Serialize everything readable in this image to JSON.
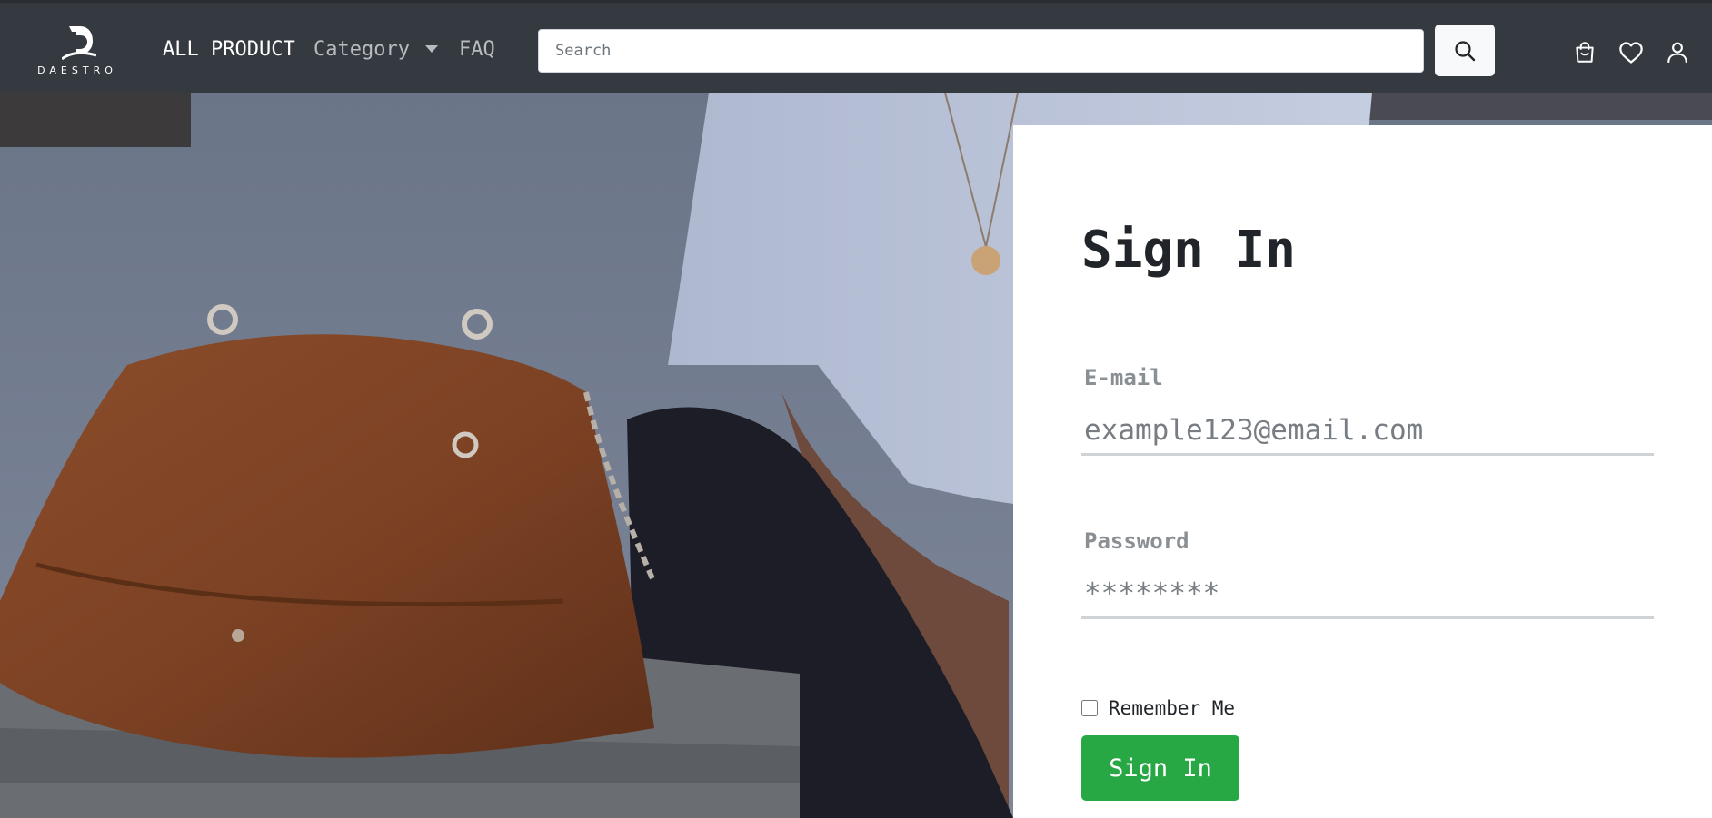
{
  "brand": {
    "name": "DAESTRO"
  },
  "nav": {
    "all_product": "ALL PRODUCT",
    "category": "Category",
    "faq": "FAQ"
  },
  "search": {
    "placeholder": "Search",
    "button_icon": "search-icon"
  },
  "header_icons": [
    "cart-icon",
    "heart-icon",
    "user-icon"
  ],
  "signin": {
    "title": "Sign In",
    "email_label": "E-mail",
    "email_placeholder": "example123@email.com",
    "password_label": "Password",
    "password_placeholder": "********",
    "remember_label": "Remember Me",
    "remember_checked": false,
    "submit_label": "Sign In"
  },
  "colors": {
    "navbar": "#343a40",
    "primary_button": "#28a745",
    "card": "#ffffff"
  }
}
